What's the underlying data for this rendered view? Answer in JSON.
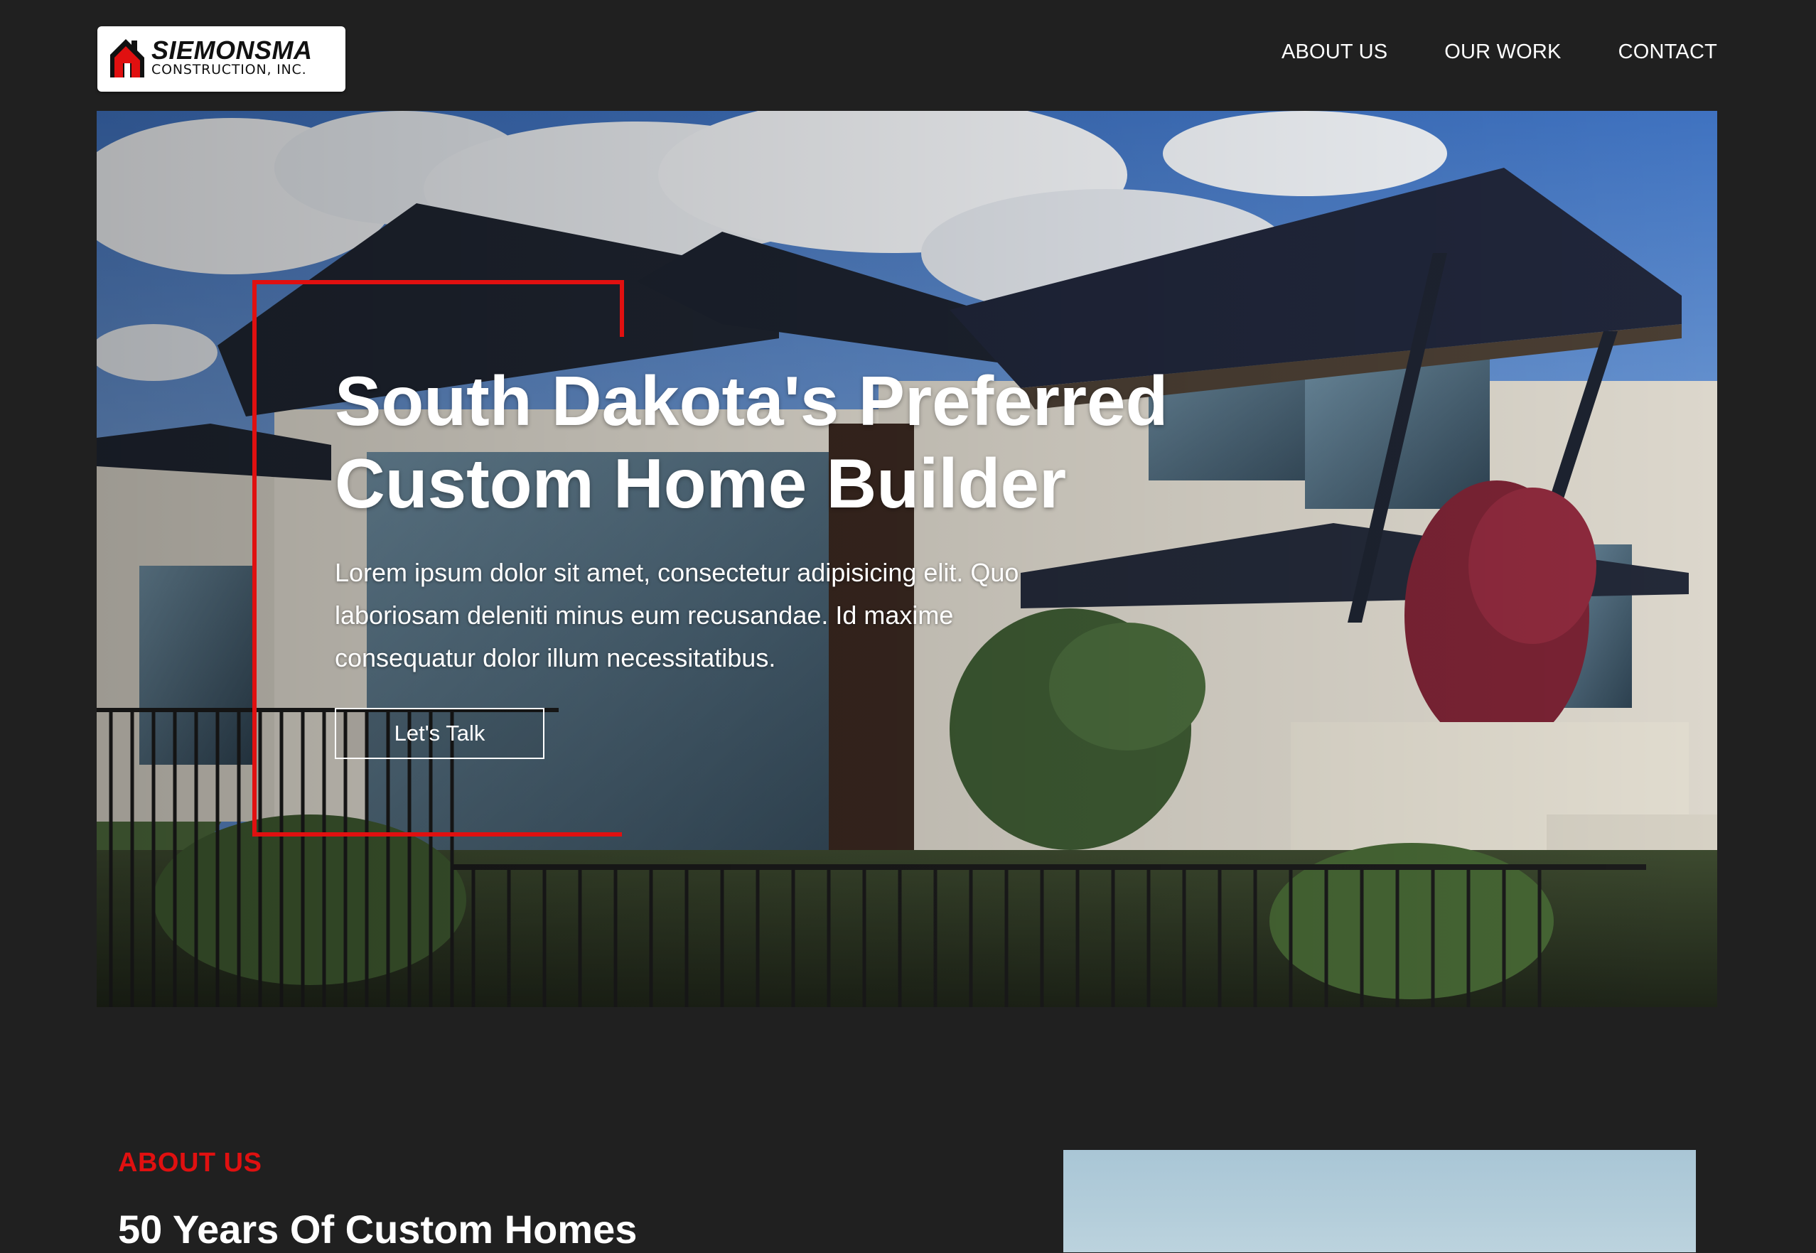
{
  "header": {
    "logo": {
      "name": "SIEMONSMA",
      "subtitle": "CONSTRUCTION, INC.",
      "icon": "house-roof-logo-icon"
    },
    "nav": [
      {
        "label": "ABOUT US"
      },
      {
        "label": "OUR WORK"
      },
      {
        "label": "CONTACT"
      }
    ]
  },
  "hero": {
    "title": "South Dakota's Preferred Custom Home Builder",
    "text": "Lorem ipsum dolor sit amet, consectetur adipisicing elit. Quo laboriosam deleniti minus eum recusandae. Id maxime consequatur dolor illum necessitatibus.",
    "button_label": "Let's Talk",
    "image": "modern-custom-home-photo"
  },
  "about": {
    "eyebrow": "ABOUT US",
    "title": "50 Years Of Custom Homes",
    "image": "sky-photo"
  },
  "colors": {
    "background": "#202020",
    "accent": "#e01010",
    "text": "#ffffff"
  }
}
